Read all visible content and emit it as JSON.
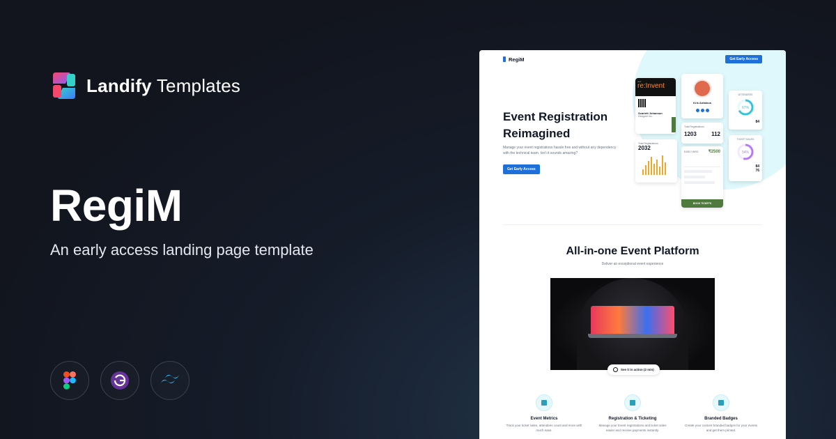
{
  "brand": {
    "name_strong": "Landify",
    "name_light": "Templates"
  },
  "hero": {
    "title": "RegiM",
    "subtitle": "An early access landing page template"
  },
  "tools": [
    "figma-icon",
    "gatsby-icon",
    "tailwind-icon"
  ],
  "colors": {
    "accent": "#1e6fd9",
    "background": "#12151e",
    "brand_gradient": [
      "#f5476b",
      "#8f5cff",
      "#35d0c7"
    ]
  },
  "mockup": {
    "logo": "RegiM",
    "nav_button": "Get Early Access",
    "heading_line1": "Event Registration",
    "heading_line2": "Reimagined",
    "description": "Manage your event registrations hassle free and without any dependency with the technical team. Isn't it sounds amazing?",
    "cta": "Get Early Access",
    "ticket": {
      "brand_small": "aws",
      "brand": "re:Invent",
      "name": "Scarlett Johanson",
      "role": "Designer Inc."
    },
    "profile": {
      "name": "Kris Anfalova"
    },
    "stats": {
      "registrations_label": "Total Registrations",
      "registrations": "1203",
      "checkins": "112",
      "total_label": "Total Registrations",
      "total": "2032"
    },
    "attendees": {
      "label": "ATTENDEES",
      "percent": "67%",
      "checkins": "84"
    },
    "tickets": {
      "label": "TICKET SALES",
      "percent": "54%",
      "value_a": "84",
      "value_b": "76"
    },
    "early_bird": {
      "label": "EARLY BIRD",
      "price": "₹2500"
    },
    "book_button": "BOOK TICKETS",
    "section_title": "All-in-one Event Platform",
    "section_subtitle": "Deliver an exceptional event experience",
    "video_label": "See it in action (2 min)",
    "features": [
      {
        "title": "Event Metrics",
        "desc": "Track your ticket sales, attendees count and more with much ease."
      },
      {
        "title": "Registration & Ticketing",
        "desc": "Manage your Event registrations and ticket sales easier and receive payments instantly."
      },
      {
        "title": "Branded Badges",
        "desc": "Create your custom branded badges for your events and get them printed."
      }
    ]
  }
}
